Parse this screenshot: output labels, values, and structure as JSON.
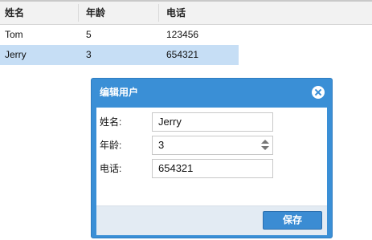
{
  "grid": {
    "columns": [
      "姓名",
      "年龄",
      "电话"
    ],
    "rows": [
      {
        "name": "Tom",
        "age": "5",
        "phone": "123456",
        "selected": false
      },
      {
        "name": "Jerry",
        "age": "3",
        "phone": "654321",
        "selected": true
      }
    ]
  },
  "dialog": {
    "title": "编辑用户",
    "fields": [
      {
        "label": "姓名:",
        "value": "Jerry"
      },
      {
        "label": "年龄:",
        "value": "3"
      },
      {
        "label": "电话:",
        "value": "654321"
      }
    ],
    "save_label": "保存"
  },
  "colors": {
    "dialog_blue": "#3a8fd6",
    "selected_row": "#c6def5",
    "footer_bg": "#e3ebf3"
  },
  "icons": {
    "close": "close-icon",
    "spinner_up": "spinner-up-icon",
    "spinner_down": "spinner-down-icon"
  }
}
